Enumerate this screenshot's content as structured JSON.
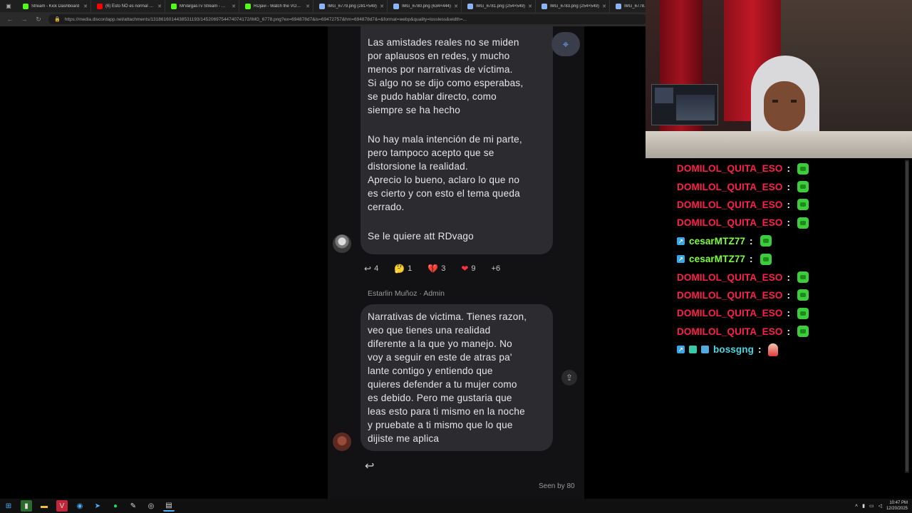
{
  "browser": {
    "tabs": [
      {
        "label": "Stream - Kick Dashboard",
        "color": "#53fc18"
      },
      {
        "label": "(6) Esto NO es normal 😳 | ...",
        "color": "#ff0000"
      },
      {
        "label": "MrVargasTv Stream - Watch ...",
        "color": "#53fc18"
      },
      {
        "label": "RDjavi - Watch the VOD on ...",
        "color": "#53fc18"
      },
      {
        "label": "IMG_6779.png (281×549)",
        "color": "#8ab4f8"
      },
      {
        "label": "IMG_6780.png (634×444)",
        "color": "#8ab4f8"
      },
      {
        "label": "IMG_6781.png (254×549)",
        "color": "#8ab4f8"
      },
      {
        "label": "IMG_6783.png (254×549)",
        "color": "#8ab4f8"
      },
      {
        "label": "IMG_6778.p",
        "color": "#8ab4f8"
      }
    ],
    "url": "https://media.discordapp.net/attachments/1318616014438531193/1452069754474074172/IMG_6778.png?ex=694878d7&is=69472757&hm=694878d7&=&format=webp&quality=lossless&width=..."
  },
  "messages": {
    "first": {
      "paragraphs": [
        [
          "Las amistades reales no se miden",
          "por aplausos en redes, y mucho",
          "menos por narrativas de víctima.",
          "Si algo no se dijo como esperabas,",
          "se pudo hablar directo, como",
          "siempre se ha hecho"
        ],
        [
          "No hay mala intención de mi parte,",
          "pero tampoco acepto que se",
          "distorsione la realidad.",
          "Aprecio lo bueno, aclaro lo que no",
          "es cierto y con esto el tema queda",
          "cerrado."
        ],
        [
          "Se le quiere att RDvago"
        ]
      ]
    },
    "reactions": [
      {
        "icon": "reply-icon",
        "glyph": "↩",
        "count": "4"
      },
      {
        "icon": "thinking-emoji-icon",
        "glyph": "🤔",
        "count": "1"
      },
      {
        "icon": "broken-heart-icon",
        "glyph": "💔",
        "count": "3"
      },
      {
        "icon": "heart-icon",
        "glyph": "❤",
        "count": "9"
      },
      {
        "icon": "more-reactions",
        "glyph": "",
        "count": "+6"
      }
    ],
    "admin_label": "Estarlin Muñoz · Admin",
    "second": {
      "lines": [
        "Narrativas de victima. Tienes razon,",
        "veo que tienes una realidad",
        "diferente a la que yo manejo. No",
        "voy a seguir en este de atras pa'",
        "lante contigo y entiendo que",
        "quieres defender a tu mujer como",
        "es debido. Pero me gustaria que",
        "leas esto para ti mismo en la noche",
        "y pruebate a ti mismo que lo que",
        "dijiste me aplica"
      ]
    },
    "seen_by": "Seen by 80"
  },
  "chat": {
    "rows": [
      {
        "name": "DOMILOL_QUITA_ESO",
        "color": "#ff1f4b",
        "badges": [],
        "emote": "green"
      },
      {
        "name": "DOMILOL_QUITA_ESO",
        "color": "#ff1f4b",
        "badges": [],
        "emote": "green"
      },
      {
        "name": "DOMILOL_QUITA_ESO",
        "color": "#ff1f4b",
        "badges": [],
        "emote": "green"
      },
      {
        "name": "DOMILOL_QUITA_ESO",
        "color": "#ff1f4b",
        "badges": [],
        "emote": "green"
      },
      {
        "name": "cesarMTZ77",
        "color": "#7cff3a",
        "badges": [
          "sub"
        ],
        "emote": "green"
      },
      {
        "name": "cesarMTZ77",
        "color": "#7cff3a",
        "badges": [
          "sub"
        ],
        "emote": "green"
      },
      {
        "name": "DOMILOL_QUITA_ESO",
        "color": "#ff1f4b",
        "badges": [],
        "emote": "green"
      },
      {
        "name": "DOMILOL_QUITA_ESO",
        "color": "#ff1f4b",
        "badges": [],
        "emote": "green"
      },
      {
        "name": "DOMILOL_QUITA_ESO",
        "color": "#ff1f4b",
        "badges": [],
        "emote": "green"
      },
      {
        "name": "DOMILOL_QUITA_ESO",
        "color": "#ff1f4b",
        "badges": [],
        "emote": "green"
      },
      {
        "name": "bossgng",
        "color": "#4ad6e0",
        "badges": [
          "sub",
          "gift",
          "vip"
        ],
        "emote": "flame"
      }
    ],
    "separator": ":"
  },
  "taskbar": {
    "time": "10:47 PM",
    "date": "12/20/2025"
  }
}
